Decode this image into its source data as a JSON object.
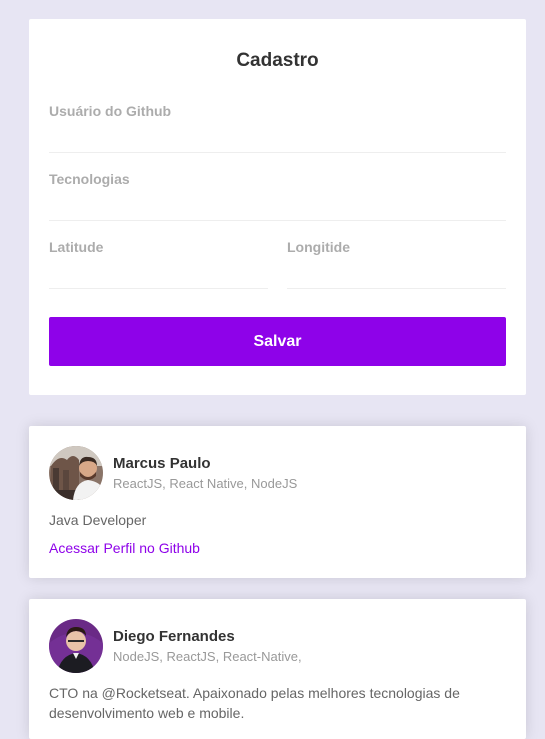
{
  "sidebar": {
    "title": "Cadastro",
    "fields": {
      "github_username": {
        "label": "Usuário do Github",
        "value": ""
      },
      "techs": {
        "label": "Tecnologias",
        "value": ""
      },
      "latitude": {
        "label": "Latitude",
        "value": ""
      },
      "longitude": {
        "label": "Longitide",
        "value": ""
      }
    },
    "save_label": "Salvar"
  },
  "devs": [
    {
      "name": "Marcus Paulo",
      "techs": "ReactJS, React Native, NodeJS",
      "bio": "Java Developer",
      "link_label": "Acessar Perfil no Github"
    },
    {
      "name": "Diego Fernandes",
      "techs": "NodeJS, ReactJS, React-Native,",
      "bio": "CTO na @Rocketseat. Apaixonado pelas melhores tecnologias de desenvolvimento web e mobile.",
      "link_label": ""
    }
  ],
  "colors": {
    "background": "#e7e5f3",
    "accent": "#8e02e9",
    "card": "#ffffff"
  },
  "icons": [
    "avatar-marcus-paulo",
    "avatar-diego-fernandes"
  ]
}
